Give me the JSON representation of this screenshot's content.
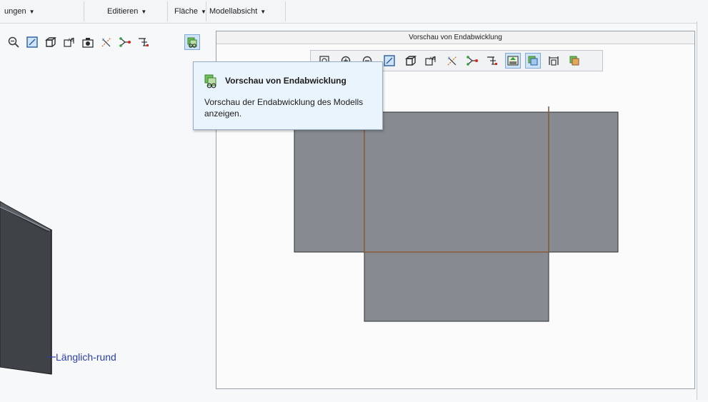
{
  "menubar": {
    "items": [
      {
        "label": "ungen",
        "arrow": "▼"
      },
      {
        "label": "Editieren",
        "arrow": "▼"
      },
      {
        "label": "Fläche",
        "arrow": "▼"
      },
      {
        "label": "Modellabsicht",
        "arrow": "▼"
      }
    ]
  },
  "left_toolbar": {
    "icons": [
      "zoom-out-icon",
      "refit-icon",
      "display-style-icon",
      "saved-views-icon",
      "view-manager-icon",
      "datum-display-icon",
      "spin-center-icon",
      "annotation-display-icon",
      "flat-pattern-preview-icon"
    ],
    "active": "flat-pattern-preview-icon"
  },
  "preview": {
    "title": "Vorschau von Endabwicklung",
    "toolbar_icons": [
      "refit-icon",
      "zoom-in-icon",
      "zoom-out-icon",
      "repaint-icon",
      "display-style-icon",
      "saved-views-icon",
      "datum-display-icon",
      "spin-center-icon",
      "annotation-display-icon",
      "orient-icon",
      "overlay-icon",
      "dimension-icon",
      "flat-pattern-icon"
    ]
  },
  "tooltip": {
    "title": "Vorschau von Endabwicklung",
    "body": "Vorschau der Endabwicklung des Modells anzeigen."
  },
  "viewport": {
    "dimension_label": "Länglich-rund"
  },
  "colors": {
    "sheet_fill": "#878b91",
    "sheet_edge": "#2d2f33",
    "bend_line": "#8a5a36",
    "model_dark": "#4a4d52",
    "accent": "#2a3ea8"
  }
}
